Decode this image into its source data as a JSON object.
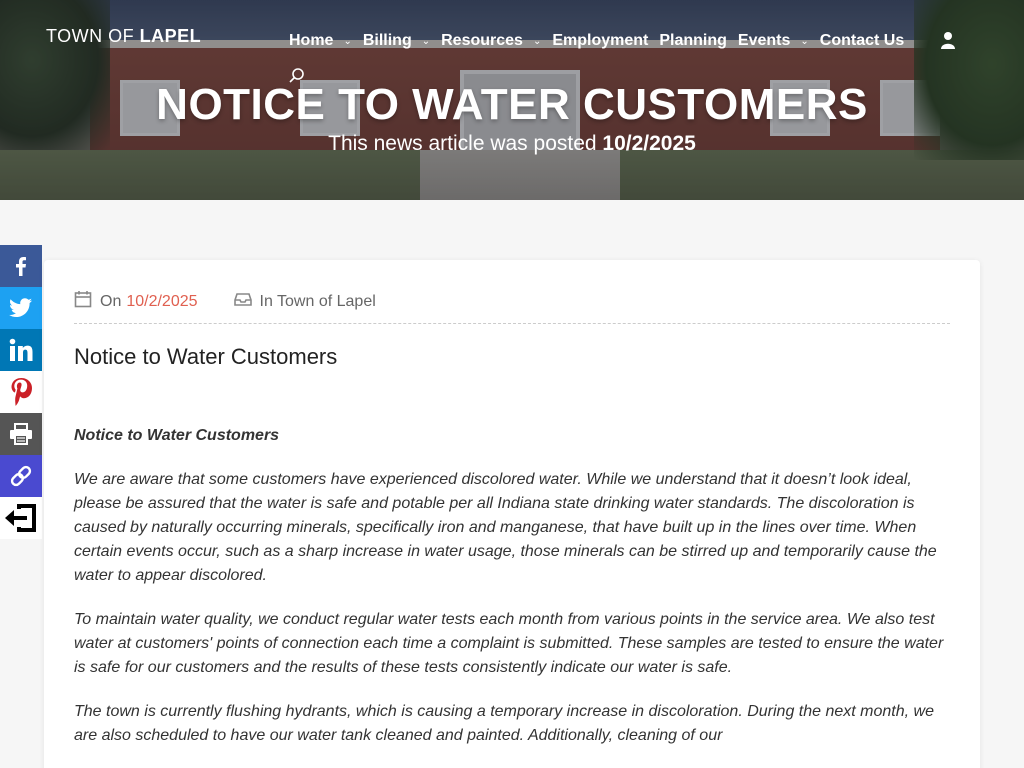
{
  "site": {
    "logo_prefix": "TOWN OF",
    "logo_name": "LAPEL"
  },
  "nav": {
    "items": [
      {
        "label": "Home",
        "has_dropdown": true
      },
      {
        "label": "Billing",
        "has_dropdown": true
      },
      {
        "label": "Resources",
        "has_dropdown": true
      },
      {
        "label": "Employment",
        "has_dropdown": false
      },
      {
        "label": "Planning",
        "has_dropdown": false
      },
      {
        "label": "Events",
        "has_dropdown": true
      },
      {
        "label": "Contact Us",
        "has_dropdown": false
      }
    ],
    "icons": [
      "user-icon",
      "search-icon"
    ]
  },
  "hero": {
    "title": "NOTICE TO WATER CUSTOMERS",
    "subtitle_prefix": "This news article was posted",
    "subtitle_date": "10/2/2025"
  },
  "share": [
    {
      "name": "facebook",
      "icon": "facebook-icon",
      "color": "#3b5998"
    },
    {
      "name": "twitter",
      "icon": "twitter-icon",
      "color": "#1da1f2"
    },
    {
      "name": "linkedin",
      "icon": "linkedin-icon",
      "color": "#0077b5"
    },
    {
      "name": "pinterest",
      "icon": "pinterest-icon",
      "color": "#ffffff"
    },
    {
      "name": "print",
      "icon": "print-icon",
      "color": "#555555"
    },
    {
      "name": "copy-link",
      "icon": "link-icon",
      "color": "#4a4ad0"
    },
    {
      "name": "exit",
      "icon": "exit-icon",
      "color": "#ffffff"
    }
  ],
  "post": {
    "meta_on": "On",
    "meta_date": "10/2/2025",
    "meta_in": "In Town of Lapel",
    "title": "Notice to Water Customers",
    "lead": "Notice to Water Customers",
    "paragraphs": [
      "We are aware that some customers have experienced discolored water. While we understand that it doesn’t look ideal, please be assured that the water is safe and potable per all Indiana state drinking water standards. The discoloration is caused by naturally occurring minerals, specifically iron and manganese, that have built up in the lines over time. When certain events occur, such as a sharp increase in water usage, those minerals can be stirred up and temporarily cause the water to appear discolored.",
      "To maintain water quality, we conduct regular water tests each month from various points in the service area. We also test water at customers' points of connection each time a complaint is submitted. These samples are tested to ensure the water is safe for our customers and the results of these tests consistently indicate our water is safe.",
      "The town is currently flushing hydrants, which is causing a temporary increase in discoloration. During the next month, we are also scheduled to have our water tank cleaned and painted. Additionally, cleaning of our"
    ]
  },
  "colors": {
    "accent": "#e06050",
    "facebook": "#3b5998",
    "twitter": "#1da1f2",
    "linkedin": "#0077b5",
    "print": "#555555",
    "copy": "#4a4ad0"
  }
}
